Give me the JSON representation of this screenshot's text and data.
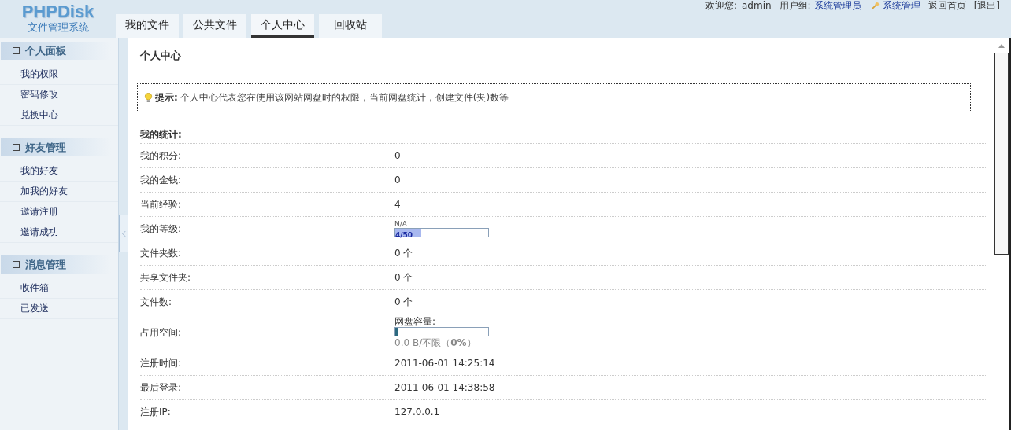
{
  "header": {
    "logo": {
      "title": "PHPDisk",
      "subtitle": "文件管理系统"
    },
    "tabs": [
      {
        "label": "我的文件",
        "selected": false
      },
      {
        "label": "公共文件",
        "selected": false
      },
      {
        "label": "个人中心",
        "selected": true
      },
      {
        "label": "回收站",
        "selected": false
      }
    ],
    "user_bar": {
      "welcome_label": "欢迎您:",
      "username": "admin",
      "group_label": "用户组:",
      "group": "系统管理员",
      "admin_link": "系统管理",
      "home_link": "返回首页",
      "logout_link": "[退出]"
    }
  },
  "sidebar": {
    "groups": [
      {
        "title": "个人面板",
        "items": [
          "我的权限",
          "密码修改",
          "兑换中心"
        ]
      },
      {
        "title": "好友管理",
        "items": [
          "我的好友",
          "加我的好友",
          "邀请注册",
          "邀请成功"
        ]
      },
      {
        "title": "消息管理",
        "items": [
          "收件箱",
          "已发送"
        ]
      }
    ]
  },
  "content": {
    "title": "个人中心",
    "tip": {
      "label": "提示:",
      "text": "个人中心代表您在使用该网站网盘时的权限，当前网盘统计，创建文件(夹)数等"
    },
    "section_title": "我的统计:",
    "rows": [
      {
        "kind": "text",
        "label": "我的积分:",
        "value": "0"
      },
      {
        "kind": "text",
        "label": "我的金钱:",
        "value": "0"
      },
      {
        "kind": "text",
        "label": "当前经验:",
        "value": "4"
      },
      {
        "kind": "level",
        "label": "我的等级:",
        "caption": "N/A",
        "bar_text": "4/50",
        "level": 0.28
      },
      {
        "kind": "text",
        "label": "文件夹数:",
        "value": "0 个"
      },
      {
        "kind": "text",
        "label": "共享文件夹:",
        "value": "0 个"
      },
      {
        "kind": "text",
        "label": "文件数:",
        "value": "0 个"
      },
      {
        "kind": "storage",
        "label": "占用空间:",
        "caption": "网盘容量:",
        "level": 0.03,
        "reading": "0.0 B/不限（**0%**）"
      },
      {
        "kind": "text",
        "label": "注册时间:",
        "value": "2011-06-01 14:25:14"
      },
      {
        "kind": "text",
        "label": "最后登录:",
        "value": "2011-06-01 14:38:58"
      },
      {
        "kind": "text",
        "label": "注册IP:",
        "value": "127.0.0.1"
      }
    ]
  }
}
